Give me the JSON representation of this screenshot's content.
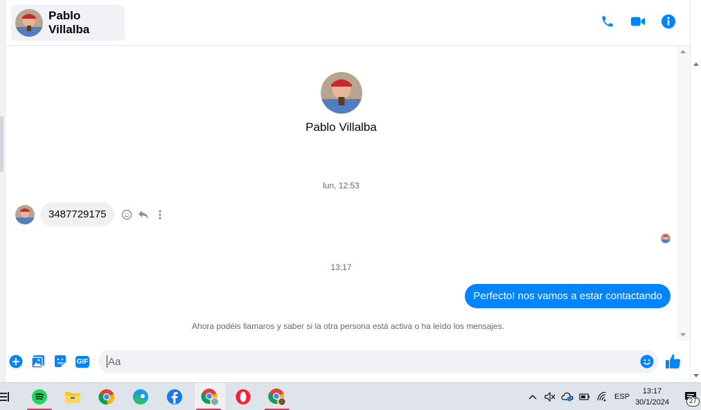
{
  "header": {
    "contact_name": "Pablo Villalba",
    "icons": [
      "phone-icon",
      "video-icon",
      "info-icon"
    ]
  },
  "profile": {
    "name": "Pablo Villalba"
  },
  "conversation": {
    "timestamp_1": "lun, 12:53",
    "incoming_message": "3487729175",
    "timestamp_2": "13:17",
    "outgoing_message": "Perfecto! nos vamos a estar contactando",
    "system_note": "Ahora podéis llamaros y saber si la otra persona está activa o ha leído los mensajes."
  },
  "composer": {
    "placeholder": "Aa",
    "icons": [
      "add-icon",
      "photo-icon",
      "sticker-icon",
      "gif-icon",
      "emoji-icon",
      "thumbs-up-icon"
    ],
    "gif_label": "GIF"
  },
  "taskbar": {
    "apps": [
      "spotify-icon",
      "file-explorer-icon",
      "chrome-icon",
      "edge-icon",
      "facebook-icon",
      "chrome-profile-icon",
      "opera-icon",
      "chrome-profile-2-icon"
    ],
    "language": "ESP",
    "time": "13:17",
    "date": "30/1/2024",
    "notification_count": "27"
  },
  "colors": {
    "accent": "#0084ff",
    "bubble_incoming": "#f0f0f0",
    "taskbar": "#dfe3ea"
  }
}
